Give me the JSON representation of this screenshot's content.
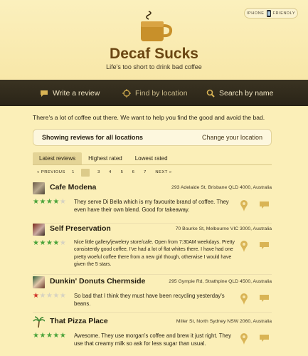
{
  "header": {
    "badge_left": "IPHONE",
    "badge_right": "FRIENDLY",
    "title": "Decaf Sucks",
    "tagline": "Life's too short to drink bad coffee"
  },
  "nav": {
    "write_review": "Write a review",
    "find_by_location": "Find by location",
    "search_by_name": "Search by name"
  },
  "intro": "There's a lot of coffee out there. We want to help you find the good and avoid the bad.",
  "location": {
    "showing": "Showing reviews for all locations",
    "change": "Change your location"
  },
  "tabs": [
    "Latest reviews",
    "Highest rated",
    "Lowest rated"
  ],
  "pager": {
    "previous": "« PREVIOUS",
    "pages": [
      "1",
      "2",
      "3",
      "4",
      "5",
      "6",
      "7"
    ],
    "current_page": 2,
    "next": "NEXT »"
  },
  "reviews": [
    {
      "name": "Cafe Modena",
      "address": "293 Adelaide St, Brisbane QLD 4000, Australia",
      "rating": 4,
      "text": "They serve Di Bella which is my favourite brand of coffee. They even have their own blend. Good for takeaway."
    },
    {
      "name": "Self Preservation",
      "address": "70 Bourke St, Melbourne VIC 3000, Australia",
      "rating": 4,
      "text": "Nice little gallery/jewelery store/cafe. Open from 7:30AM weekdays. Pretty consistently good coffee, I've had a lot of flat whites there. I have had one pretty woeful coffee there from a new girl though, otherwise I would have given the 5 stars."
    },
    {
      "name": "Dunkin' Donuts Chermside",
      "address": "295 Gympie Rd, Strathpine QLD 4500, Australia",
      "rating": 1,
      "text": "So bad that I think they must have been recycling yesterday's beans."
    },
    {
      "name": "That Pizza Place",
      "address": "Miller St, North Sydney NSW 2060, Australia",
      "rating": 5,
      "text": "Awesome. They use morgan's coffee and brew it just right. They use that creamy milk so ask for less sugar than usual."
    }
  ],
  "colors": {
    "background": "#fbefb8",
    "navbar": "#2f2a1c",
    "title_brown": "#6a4612",
    "star_green": "#4aa33a",
    "star_red": "#d0352a"
  }
}
